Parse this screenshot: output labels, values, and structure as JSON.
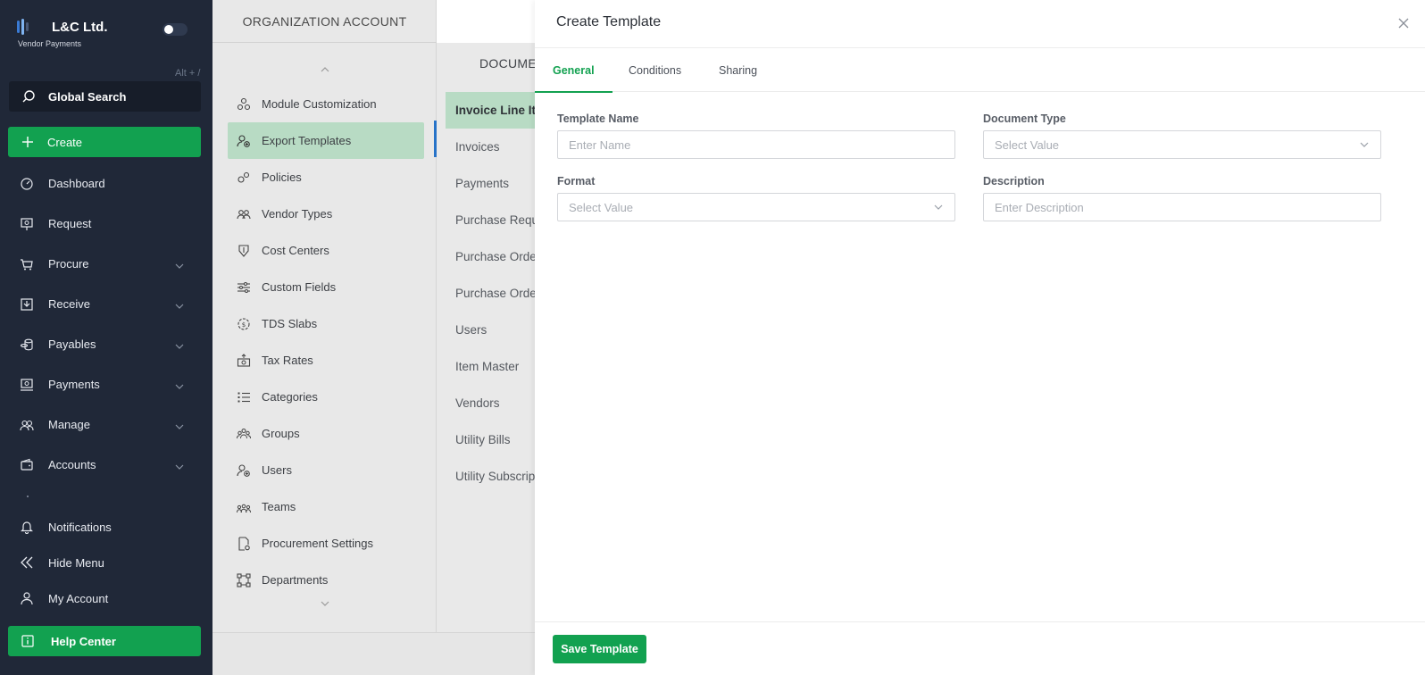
{
  "brand": {
    "name": "L&C Ltd.",
    "subtitle": "Vendor Payments"
  },
  "sidebar": {
    "shortcut_hint": "Alt + /",
    "search_label": "Global Search",
    "create_label": "Create",
    "items": [
      {
        "label": "Dashboard",
        "icon": "dashboard-icon",
        "expandable": false
      },
      {
        "label": "Request",
        "icon": "request-icon",
        "expandable": false
      },
      {
        "label": "Procure",
        "icon": "cart-icon",
        "expandable": true
      },
      {
        "label": "Receive",
        "icon": "receive-icon",
        "expandable": true
      },
      {
        "label": "Payables",
        "icon": "coins-icon",
        "expandable": true
      },
      {
        "label": "Payments",
        "icon": "payments-icon",
        "expandable": true
      },
      {
        "label": "Manage",
        "icon": "users-icon",
        "expandable": true
      },
      {
        "label": "Accounts",
        "icon": "wallet-icon",
        "expandable": true
      }
    ],
    "bottom_items": [
      {
        "label": "Notifications",
        "icon": "bell-icon"
      },
      {
        "label": "Hide Menu",
        "icon": "double-chevron-left-icon"
      },
      {
        "label": "My Account",
        "icon": "user-icon"
      }
    ],
    "help_label": "Help Center"
  },
  "settings": {
    "header": "ORGANIZATION ACCOUNT",
    "items": [
      {
        "label": "Module Customization",
        "icon": "modules-icon",
        "active": false
      },
      {
        "label": "Export Templates",
        "icon": "user-gear-icon",
        "active": true
      },
      {
        "label": "Policies",
        "icon": "gears-icon",
        "active": false
      },
      {
        "label": "Vendor Types",
        "icon": "vendors-icon",
        "active": false
      },
      {
        "label": "Cost Centers",
        "icon": "cost-center-icon",
        "active": false
      },
      {
        "label": "Custom Fields",
        "icon": "sliders-icon",
        "active": false
      },
      {
        "label": "TDS Slabs",
        "icon": "tds-icon",
        "active": false
      },
      {
        "label": "Tax Rates",
        "icon": "tax-icon",
        "active": false
      },
      {
        "label": "Categories",
        "icon": "list-icon",
        "active": false
      },
      {
        "label": "Groups",
        "icon": "groups-icon",
        "active": false
      },
      {
        "label": "Users",
        "icon": "user-settings-icon",
        "active": false
      },
      {
        "label": "Teams",
        "icon": "teams-icon",
        "active": false
      },
      {
        "label": "Procurement Settings",
        "icon": "doc-gear-icon",
        "active": false
      },
      {
        "label": "Departments",
        "icon": "departments-icon",
        "active": false
      }
    ]
  },
  "documents": {
    "header": "DOCUME",
    "items": [
      {
        "label": "Invoice Line Ite",
        "active": true
      },
      {
        "label": "Invoices",
        "active": false
      },
      {
        "label": "Payments",
        "active": false
      },
      {
        "label": "Purchase Requ",
        "active": false
      },
      {
        "label": "Purchase Orde",
        "active": false
      },
      {
        "label": "Purchase Orde",
        "active": false
      },
      {
        "label": "Users",
        "active": false
      },
      {
        "label": "Item Master",
        "active": false
      },
      {
        "label": "Vendors",
        "active": false
      },
      {
        "label": "Utility Bills",
        "active": false
      },
      {
        "label": "Utility Subscrip",
        "active": false
      }
    ]
  },
  "modal": {
    "title": "Create Template",
    "tabs": [
      {
        "label": "General",
        "active": true
      },
      {
        "label": "Conditions",
        "active": false
      },
      {
        "label": "Sharing",
        "active": false
      }
    ],
    "fields": {
      "template_name": {
        "label": "Template Name",
        "placeholder": "Enter Name"
      },
      "document_type": {
        "label": "Document Type",
        "placeholder": "Select Value"
      },
      "format": {
        "label": "Format",
        "placeholder": "Select Value"
      },
      "description": {
        "label": "Description",
        "placeholder": "Enter Description"
      }
    },
    "save_label": "Save Template"
  },
  "colors": {
    "accent": "#12a150",
    "sidebar_bg": "#202838",
    "active_tint": "#b8dbc4",
    "active_bar": "#2773c8"
  }
}
